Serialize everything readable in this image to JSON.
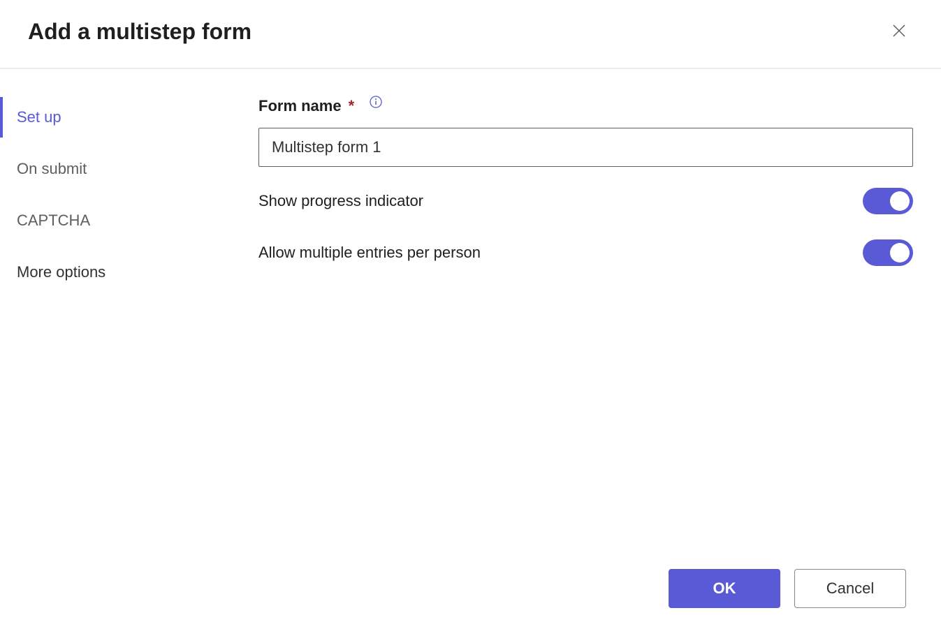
{
  "header": {
    "title": "Add a multistep form"
  },
  "sidebar": {
    "items": [
      {
        "label": "Set up",
        "active": true
      },
      {
        "label": "On submit",
        "active": false
      },
      {
        "label": "CAPTCHA",
        "active": false
      },
      {
        "label": "More options",
        "active": false
      }
    ]
  },
  "form": {
    "name_label": "Form name",
    "name_value": "Multistep form 1",
    "progress_label": "Show progress indicator",
    "progress_on": true,
    "multiple_label": "Allow multiple entries per person",
    "multiple_on": true
  },
  "footer": {
    "ok_label": "OK",
    "cancel_label": "Cancel"
  }
}
